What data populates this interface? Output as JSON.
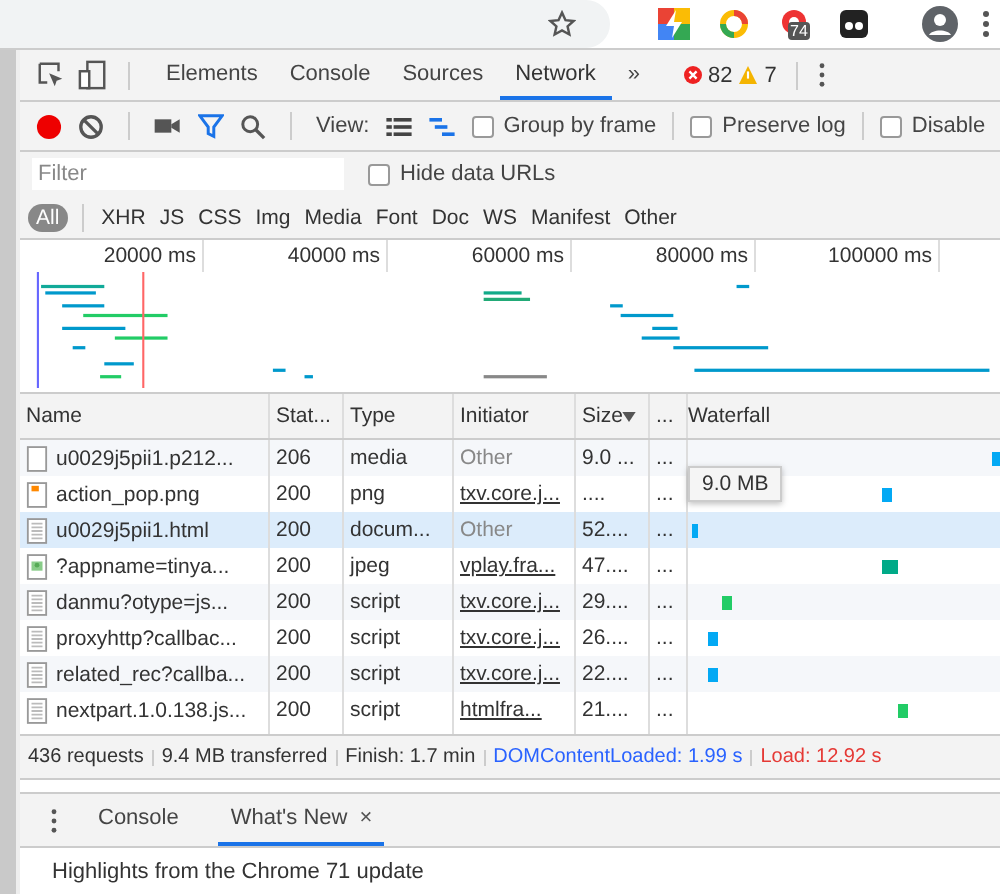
{
  "devtools_tabs": [
    {
      "label": "Elements",
      "selected": false
    },
    {
      "label": "Console",
      "selected": false
    },
    {
      "label": "Sources",
      "selected": false
    },
    {
      "label": "Network",
      "selected": true
    },
    {
      "label": "»",
      "selected": false
    }
  ],
  "browser_badge": "74",
  "errors": "82",
  "warnings": "7",
  "toolbar": {
    "view_label": "View:",
    "options": [
      {
        "label": "Group by frame",
        "checked": false
      },
      {
        "label": "Preserve log",
        "checked": false
      },
      {
        "label": "Disable",
        "checked": false
      }
    ]
  },
  "filter": {
    "placeholder": "Filter",
    "hide_data_urls": {
      "label": "Hide data URLs",
      "checked": false
    }
  },
  "type_filters": [
    {
      "label": "All",
      "selected": true
    },
    {
      "label": "XHR",
      "selected": false
    },
    {
      "label": "JS",
      "selected": false
    },
    {
      "label": "CSS",
      "selected": false
    },
    {
      "label": "Img",
      "selected": false
    },
    {
      "label": "Media",
      "selected": false
    },
    {
      "label": "Font",
      "selected": false
    },
    {
      "label": "Doc",
      "selected": false
    },
    {
      "label": "WS",
      "selected": false
    },
    {
      "label": "Manifest",
      "selected": false
    },
    {
      "label": "Other",
      "selected": false
    }
  ],
  "overview": {
    "ticks": [
      "20000 ms",
      "40000 ms",
      "60000 ms",
      "80000 ms",
      "100000 ms"
    ]
  },
  "table": {
    "columns": [
      "Name",
      "Stat...",
      "Type",
      "Initiator",
      "Size",
      "...",
      "Waterfall"
    ],
    "rows": [
      {
        "kind": "blank",
        "name": "u0029j5pii1.p212...",
        "status": "206",
        "type": "media",
        "initiator": "Other",
        "initiator_link": false,
        "size": "9.0 ...",
        "time": "...",
        "selected": false
      },
      {
        "kind": "image",
        "name": "action_pop.png",
        "status": "200",
        "type": "png",
        "initiator": "txv.core.j...",
        "initiator_link": true,
        "size": "....",
        "time": "...",
        "selected": false
      },
      {
        "kind": "document",
        "name": "u0029j5pii1.html",
        "status": "200",
        "type": "docum...",
        "initiator": "Other",
        "initiator_link": false,
        "size": "52....",
        "time": "...",
        "selected": true
      },
      {
        "kind": "photo",
        "name": "?appname=tinya...",
        "status": "200",
        "type": "jpeg",
        "initiator": "vplay.fra...",
        "initiator_link": true,
        "size": "47....",
        "time": "...",
        "selected": false
      },
      {
        "kind": "document",
        "name": "danmu?otype=js...",
        "status": "200",
        "type": "script",
        "initiator": "txv.core.j...",
        "initiator_link": true,
        "size": "29....",
        "time": "...",
        "selected": false
      },
      {
        "kind": "document",
        "name": "proxyhttp?callbac...",
        "status": "200",
        "type": "script",
        "initiator": "txv.core.j...",
        "initiator_link": true,
        "size": "26....",
        "time": "...",
        "selected": false
      },
      {
        "kind": "document",
        "name": "related_rec?callba...",
        "status": "200",
        "type": "script",
        "initiator": "txv.core.j...",
        "initiator_link": true,
        "size": "22....",
        "time": "...",
        "selected": false
      },
      {
        "kind": "document",
        "name": "nextpart.1.0.138.js...",
        "status": "200",
        "type": "script",
        "initiator": "htmlfra...",
        "initiator_link": true,
        "size": "21....",
        "time": "...",
        "selected": false
      }
    ]
  },
  "tooltip": "9.0 MB",
  "status_bar": [
    {
      "kind": "plain",
      "text": "436 requests"
    },
    {
      "kind": "plain",
      "text": "9.4 MB transferred"
    },
    {
      "kind": "plain",
      "text": "Finish: 1.7 min"
    },
    {
      "kind": "dom",
      "text": "DOMContentLoaded: 1.99 s"
    },
    {
      "kind": "load",
      "text": "Load: 12.92 s"
    }
  ],
  "drawer": {
    "tabs": [
      {
        "label": "Console",
        "selected": false,
        "closable": false
      },
      {
        "label": "What's New",
        "selected": true,
        "closable": true
      }
    ],
    "close_symbol": "×",
    "text": "Highlights from the Chrome 71 update"
  }
}
